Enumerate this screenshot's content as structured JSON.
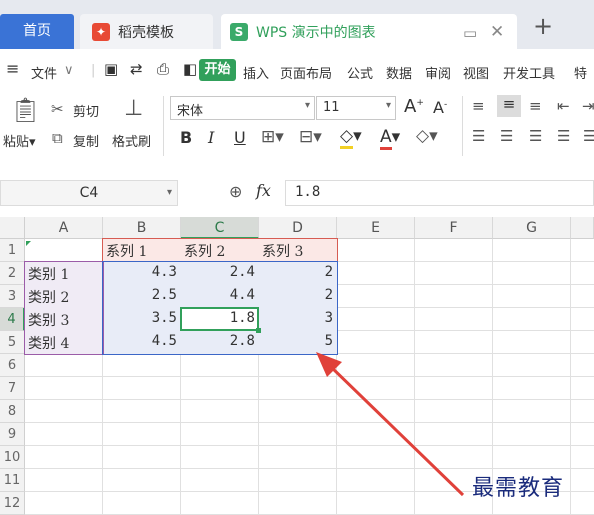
{
  "tabs": {
    "home": "首页",
    "template": "稻壳模板",
    "active": "WPS 演示中的图表",
    "template_badge": "wps-logo-icon",
    "active_badge": "S"
  },
  "menu": {
    "file": "文件",
    "items": [
      "开始",
      "插入",
      "页面布局",
      "公式",
      "数据",
      "审阅",
      "视图",
      "开发工具",
      "特"
    ]
  },
  "ribbon": {
    "paste": "粘贴",
    "cut": "剪切",
    "copy": "复制",
    "format_painter": "格式刷",
    "font": "宋体",
    "size": "11"
  },
  "formula_bar": {
    "name_box": "C4",
    "fx": "fx",
    "value": "1.8"
  },
  "sheet": {
    "columns": [
      "A",
      "B",
      "C",
      "D",
      "E",
      "F",
      "G"
    ],
    "rows": [
      "1",
      "2",
      "3",
      "4",
      "5",
      "6",
      "7",
      "8",
      "9",
      "10",
      "11",
      "12"
    ],
    "headers": [
      "系列 1",
      "系列 2",
      "系列 3"
    ],
    "categories": [
      "类别 1",
      "类别 2",
      "类别 3",
      "类别 4"
    ],
    "values": [
      [
        "4.3",
        "2.4",
        "2"
      ],
      [
        "2.5",
        "4.4",
        "2"
      ],
      [
        "3.5",
        "1.8",
        "3"
      ],
      [
        "4.5",
        "2.8",
        "5"
      ]
    ],
    "selected_column": "C",
    "selected_row": "4"
  },
  "watermark": "最需教育",
  "colors": {
    "accent_green": "#31a05b",
    "home_tab_blue": "#3a73d6",
    "annotation_red": "#e0413a"
  }
}
